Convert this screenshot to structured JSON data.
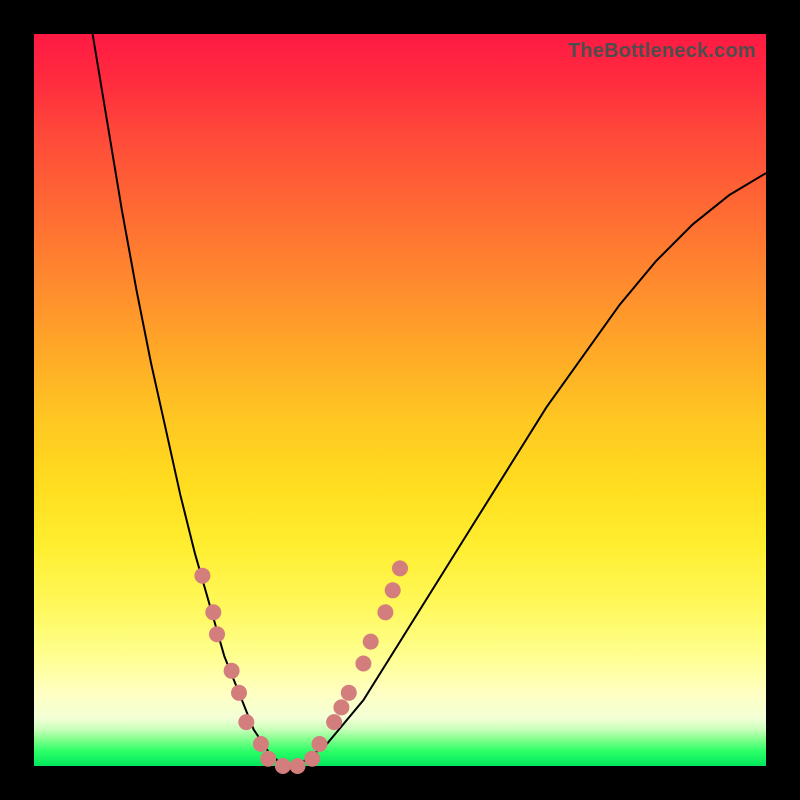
{
  "attribution": "TheBottleneck.com",
  "chart_data": {
    "type": "line",
    "title": "",
    "xlabel": "",
    "ylabel": "",
    "xlim": [
      0,
      100
    ],
    "ylim": [
      0,
      100
    ],
    "grid": false,
    "legend": false,
    "series": [
      {
        "name": "bottleneck-curve",
        "x": [
          8,
          10,
          12,
          14,
          16,
          18,
          20,
          22,
          24,
          26,
          28,
          30,
          32,
          34,
          36,
          40,
          45,
          50,
          55,
          60,
          65,
          70,
          75,
          80,
          85,
          90,
          95,
          100
        ],
        "y": [
          100,
          88,
          76,
          65,
          55,
          46,
          37,
          29,
          22,
          15,
          10,
          5,
          2,
          0,
          0,
          3,
          9,
          17,
          25,
          33,
          41,
          49,
          56,
          63,
          69,
          74,
          78,
          81
        ],
        "color": "#000000",
        "stroke_width": 2
      }
    ],
    "markers": {
      "name": "highlight-dots",
      "color": "#d47d7d",
      "radius": 8,
      "points": [
        {
          "x": 23,
          "y": 26
        },
        {
          "x": 24.5,
          "y": 21
        },
        {
          "x": 25,
          "y": 18
        },
        {
          "x": 27,
          "y": 13
        },
        {
          "x": 28,
          "y": 10
        },
        {
          "x": 29,
          "y": 6
        },
        {
          "x": 31,
          "y": 3
        },
        {
          "x": 32,
          "y": 1
        },
        {
          "x": 34,
          "y": 0
        },
        {
          "x": 36,
          "y": 0
        },
        {
          "x": 38,
          "y": 1
        },
        {
          "x": 39,
          "y": 3
        },
        {
          "x": 41,
          "y": 6
        },
        {
          "x": 42,
          "y": 8
        },
        {
          "x": 43,
          "y": 10
        },
        {
          "x": 45,
          "y": 14
        },
        {
          "x": 46,
          "y": 17
        },
        {
          "x": 48,
          "y": 21
        },
        {
          "x": 49,
          "y": 24
        },
        {
          "x": 50,
          "y": 27
        }
      ]
    }
  }
}
